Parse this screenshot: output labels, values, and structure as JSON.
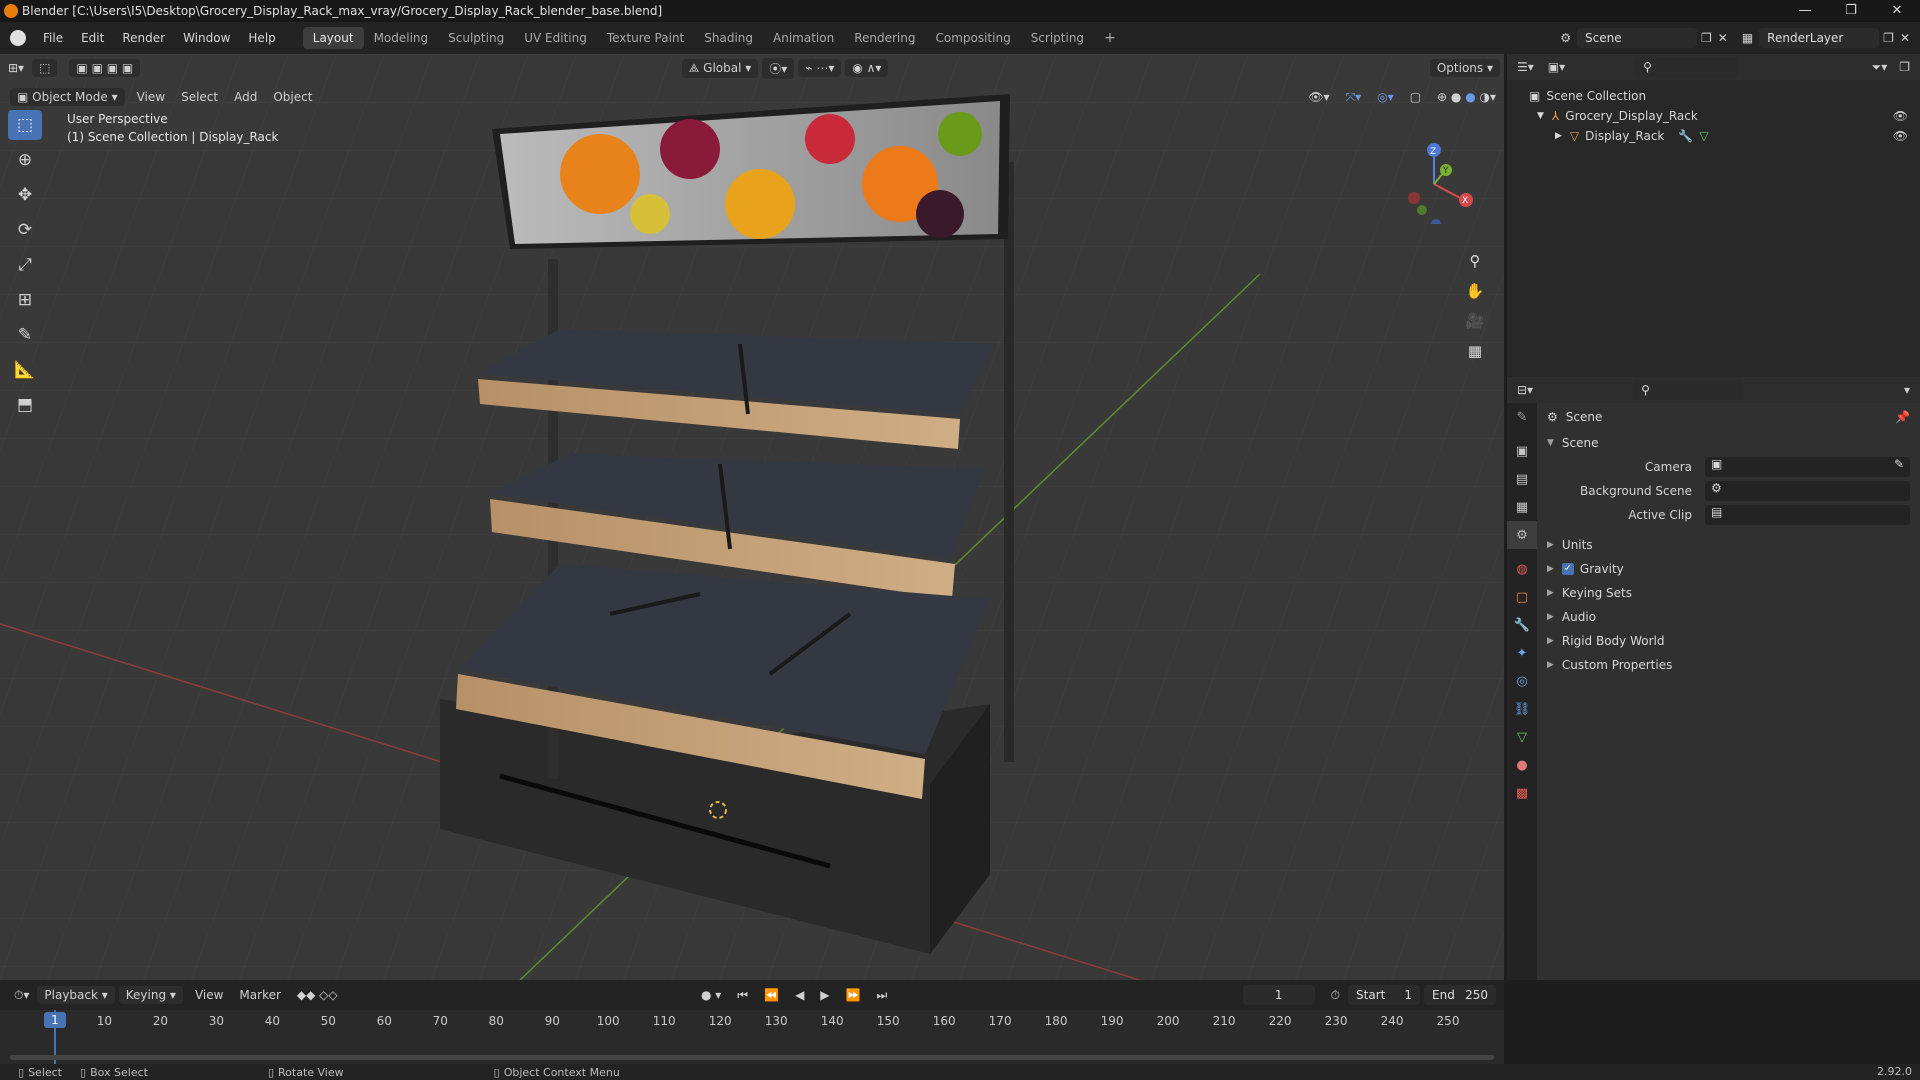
{
  "window": {
    "title": "Blender [C:\\Users\\I5\\Desktop\\Grocery_Display_Rack_max_vray/Grocery_Display_Rack_blender_base.blend]",
    "minimize": "—",
    "maximize": "❐",
    "close": "✕"
  },
  "menu": [
    "File",
    "Edit",
    "Render",
    "Window",
    "Help"
  ],
  "workspaces": [
    "Layout",
    "Modeling",
    "Sculpting",
    "UV Editing",
    "Texture Paint",
    "Shading",
    "Animation",
    "Rendering",
    "Compositing",
    "Scripting"
  ],
  "active_workspace": "Layout",
  "scene_name": "Scene",
  "view_layer": "RenderLayer",
  "viewport": {
    "mode": "Object Mode",
    "menus": [
      "View",
      "Select",
      "Add",
      "Object"
    ],
    "transform_orientation": "Global",
    "options_label": "Options",
    "info_line1": "User Perspective",
    "info_line2": "(1) Scene Collection | Display_Rack",
    "gizmo_axes": [
      "X",
      "Y",
      "Z"
    ]
  },
  "outliner": {
    "root": "Scene Collection",
    "items": [
      {
        "label": "Grocery_Display_Rack"
      },
      {
        "label": "Display_Rack"
      }
    ]
  },
  "properties": {
    "context": "Scene",
    "panel": "Scene",
    "fields": [
      {
        "label": "Camera",
        "value": ""
      },
      {
        "label": "Background Scene",
        "value": ""
      },
      {
        "label": "Active Clip",
        "value": ""
      }
    ],
    "sections": [
      {
        "label": "Units",
        "checkbox": false
      },
      {
        "label": "Gravity",
        "checkbox": true
      },
      {
        "label": "Keying Sets",
        "checkbox": false
      },
      {
        "label": "Audio",
        "checkbox": false
      },
      {
        "label": "Rigid Body World",
        "checkbox": false
      },
      {
        "label": "Custom Properties",
        "checkbox": false
      }
    ],
    "tab_colors": [
      "#9d9d9d",
      "#c6c6c6",
      "#c6c6c6",
      "#c6c6c6",
      "#bdbdbd",
      "#e05a50",
      "#e8873a",
      "#6aa6e6",
      "#6aa6e6",
      "#6aa6e6",
      "#6aa6e6",
      "#6ac36a",
      "#e07a7a",
      "#e05a50"
    ]
  },
  "timeline": {
    "menus": [
      "Playback",
      "Keying",
      "View",
      "Marker"
    ],
    "current_frame": "1",
    "start_label": "Start",
    "start": "1",
    "end_label": "End",
    "end": "250",
    "ticks": [
      "1",
      "10",
      "20",
      "30",
      "40",
      "50",
      "60",
      "70",
      "80",
      "90",
      "100",
      "110",
      "120",
      "130",
      "140",
      "150",
      "160",
      "170",
      "180",
      "190",
      "200",
      "210",
      "220",
      "230",
      "240",
      "250"
    ]
  },
  "status": {
    "select": "Select",
    "box_select": "Box Select",
    "rotate": "Rotate View",
    "context_menu": "Object Context Menu",
    "version": "2.92.0"
  },
  "colors": {
    "accent": "#4772b3",
    "orange": "#e87d0d"
  }
}
